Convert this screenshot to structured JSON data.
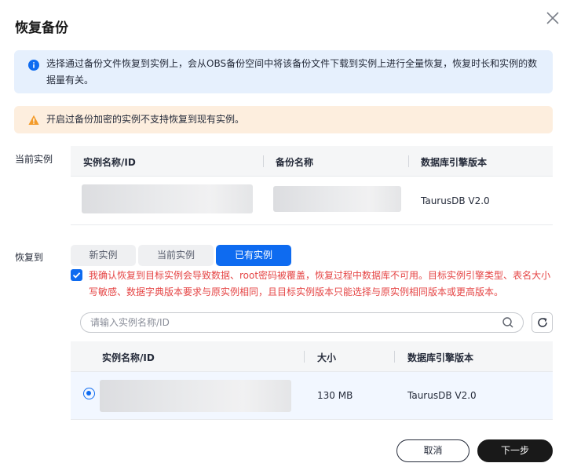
{
  "dialog": {
    "title": "恢复备份"
  },
  "alerts": {
    "info_text": "选择通过备份文件恢复到实例上，会从OBS备份空间中将该备份文件下载到实例上进行全量恢复，恢复时长和实例的数据量有关。",
    "warn_text": "开启过备份加密的实例不支持恢复到现有实例。"
  },
  "current_instance": {
    "label": "当前实例",
    "columns": [
      "实例名称/ID",
      "备份名称",
      "数据库引擎版本"
    ],
    "rows": [
      {
        "engine_version": "TaurusDB V2.0"
      }
    ]
  },
  "restore_to": {
    "label": "恢复到",
    "tabs": [
      "新实例",
      "当前实例",
      "已有实例"
    ],
    "active_tab": "已有实例",
    "confirm_checked": true,
    "confirm_text": "我确认恢复到目标实例会导致数据、root密码被覆盖，恢复过程中数据库不可用。目标实例引擎类型、表名大小写敏感、数据字典版本要求与原实例相同，且目标实例版本只能选择与原实例相同版本或更高版本。",
    "search_placeholder": "请输入实例名称/ID",
    "columns": [
      "实例名称/ID",
      "大小",
      "数据库引擎版本"
    ],
    "rows": [
      {
        "selected": true,
        "size": "130 MB",
        "engine_version": "TaurusDB V2.0"
      }
    ]
  },
  "footer": {
    "cancel_label": "取消",
    "next_label": "下一步"
  },
  "colors": {
    "primary": "#0e6bf0",
    "danger_text": "#e54545",
    "info_bg": "#e6f0fd",
    "warn_bg": "#fdeede",
    "warn_icon": "#f39b2b"
  },
  "icons": [
    "close-icon",
    "info-icon",
    "warning-icon",
    "search-icon",
    "refresh-icon",
    "check-icon"
  ]
}
